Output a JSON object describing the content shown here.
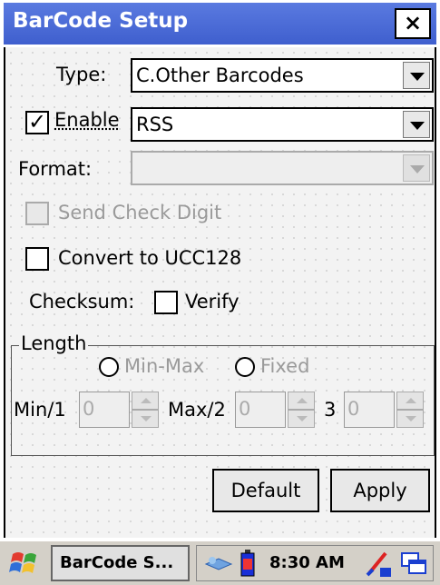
{
  "window": {
    "title": "BarCode Setup",
    "close_label": "×"
  },
  "form": {
    "type_label": "Type:",
    "type_value": "C.Other Barcodes",
    "enable_label": "Enable",
    "enable_checked": true,
    "symbology_value": "RSS",
    "format_label": "Format:",
    "format_value": "",
    "send_check_digit_label": "Send Check Digit",
    "convert_label": "Convert to UCC128",
    "checksum_label": "Checksum:",
    "verify_label": "Verify"
  },
  "length": {
    "legend": "Length",
    "radio_minmax": "Min-Max",
    "radio_fixed": "Fixed",
    "min_label": "Min/1",
    "min_value": "0",
    "max_label": "Max/2",
    "max_value": "0",
    "third_label": "3",
    "third_value": "0"
  },
  "buttons": {
    "default_label": "Default",
    "apply_label": "Apply"
  },
  "taskbar": {
    "task_label": "BarCode S...",
    "time": "8:30 AM"
  },
  "colors": {
    "titlebar": "#4a6bd8",
    "client_bg": "#f3f3f3",
    "taskbar_bg": "#d4d0c8"
  },
  "icons": [
    "close-icon",
    "dropdown-arrow-icon",
    "checkmark-icon",
    "windows-start-icon",
    "network-icon",
    "battery-icon",
    "input-panel-icon",
    "task-switch-icon"
  ]
}
